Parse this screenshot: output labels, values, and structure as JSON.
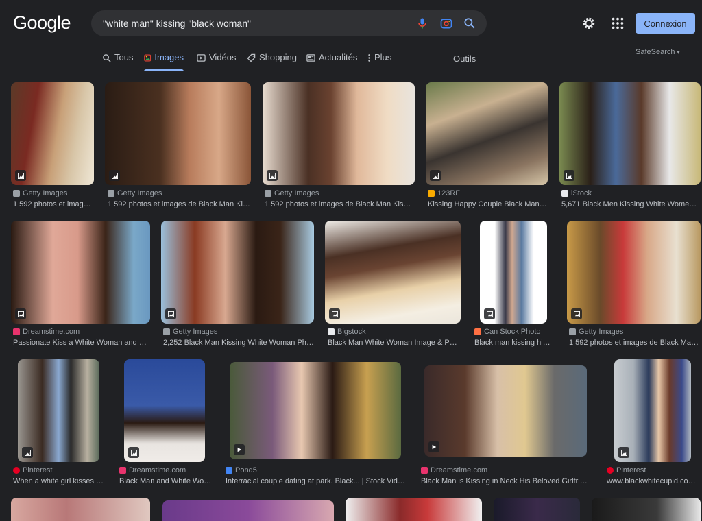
{
  "header": {
    "logo": "Google",
    "query": "\"white man\" kissing \"black woman\"",
    "signin_label": "Connexion"
  },
  "tabs": [
    {
      "label": "Tous",
      "icon": "search-icon",
      "active": false
    },
    {
      "label": "Images",
      "icon": "image-icon",
      "active": true
    },
    {
      "label": "Vidéos",
      "icon": "video-icon",
      "active": false
    },
    {
      "label": "Shopping",
      "icon": "tag-icon",
      "active": false
    },
    {
      "label": "Actualités",
      "icon": "news-icon",
      "active": false
    },
    {
      "label": "Plus",
      "icon": "more-icon",
      "active": false
    }
  ],
  "tools_label": "Outils",
  "safesearch_label": "SafeSearch",
  "results": [
    {
      "source": "Getty Images",
      "caption": "1 592 photos et image..."
    },
    {
      "source": "Getty Images",
      "caption": "1 592 photos et images de Black Man Kissi..."
    },
    {
      "source": "Getty Images",
      "caption": "1 592 photos et images de Black Man Kissin..."
    },
    {
      "source": "123RF",
      "caption": "Kissing Happy Couple Black Man A..."
    },
    {
      "source": "iStock",
      "caption": "5,671 Black Men Kissing White Women St..."
    },
    {
      "source": "Dreamstime.com",
      "caption": "Passionate Kiss a White Woman and Bla..."
    },
    {
      "source": "Getty Images",
      "caption": "2,252 Black Man Kissing White Woman Photo..."
    },
    {
      "source": "Bigstock",
      "caption": "Black Man White Woman Image & Phot..."
    },
    {
      "source": "Can Stock Photo",
      "caption": "Black man kissing his ..."
    },
    {
      "source": "Getty Images",
      "caption": "1 592 photos et images de Black Man ..."
    },
    {
      "source": "Pinterest",
      "caption": "When a white girl kisses a ..."
    },
    {
      "source": "Dreamstime.com",
      "caption": "Black Man and White Wom..."
    },
    {
      "source": "Pond5",
      "caption": "Interracial couple dating at park. Black... | Stock Video |..."
    },
    {
      "source": "Dreamstime.com",
      "caption": "Black Man is Kissing in Neck His Beloved Girlfriend ..."
    },
    {
      "source": "Pinterest",
      "caption": "www.blackwhitecupid.com ..."
    }
  ],
  "favicon_colors": {
    "getty": "#9aa0a6",
    "123rf": "#f9ab00",
    "istock": "#e8eaed",
    "dreamstime": "#e8336d",
    "bigstock": "#e8eaed",
    "canstock": "#ff7043",
    "pinterest": "#e60023",
    "pond5": "#4285f4"
  },
  "accent_color": "#8ab4f8"
}
